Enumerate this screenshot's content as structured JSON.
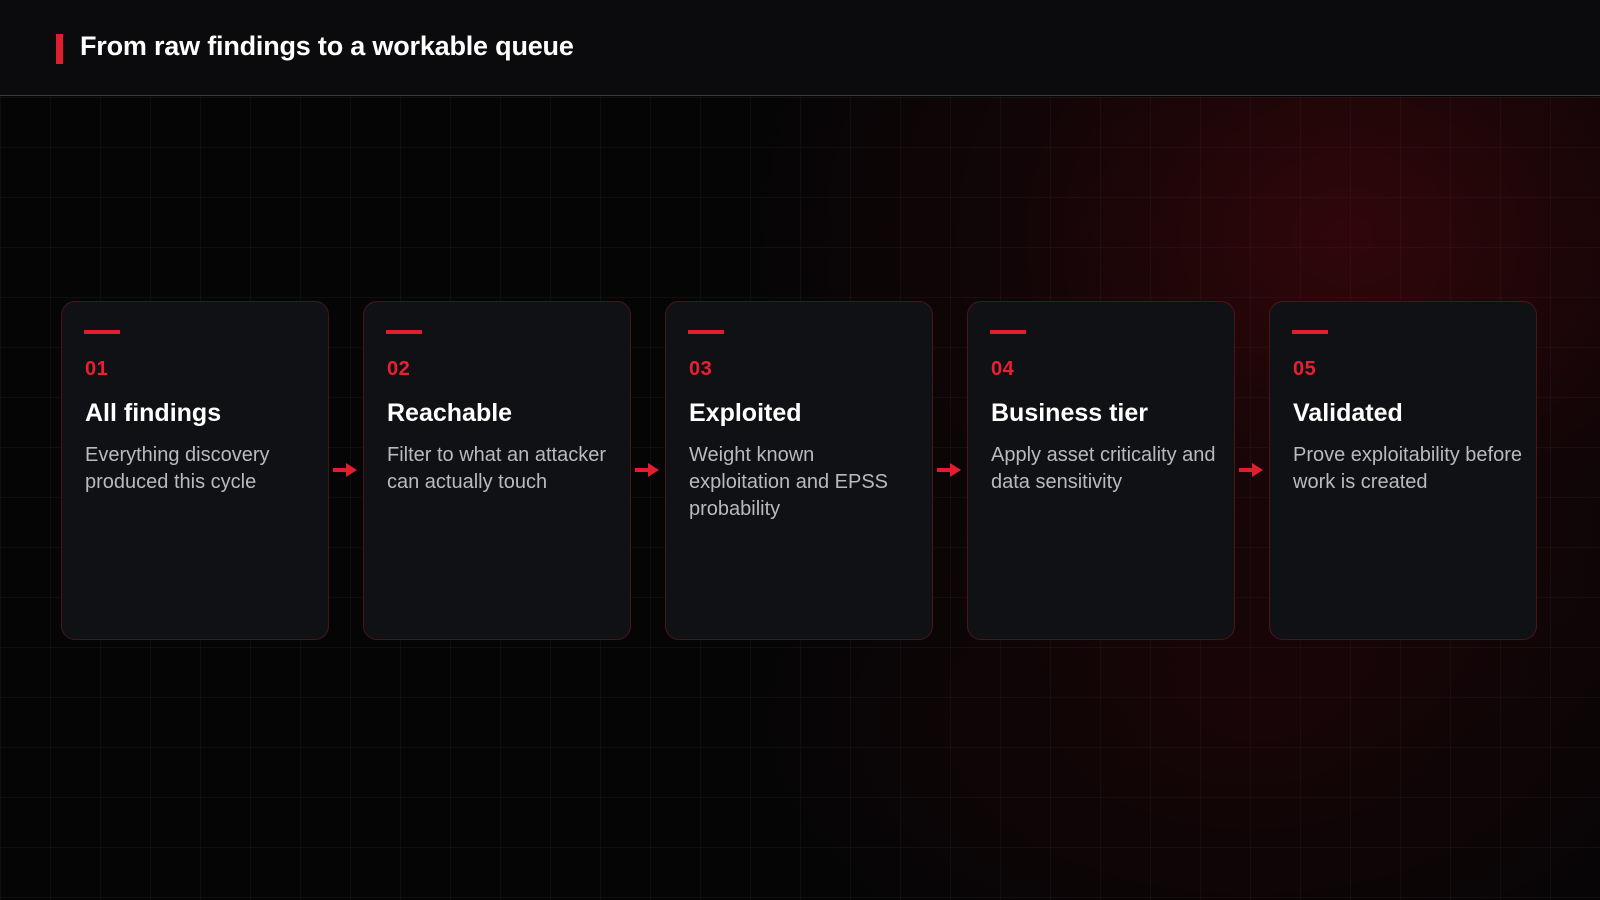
{
  "header": {
    "title": "From raw findings to a workable queue"
  },
  "colors": {
    "accent": "#e01e2d",
    "card_background": "#101115",
    "card_border": "#4a1519",
    "page_background": "#050506"
  },
  "steps": [
    {
      "number": "01",
      "title": "All findings",
      "description": "Everything discovery produced this cycle"
    },
    {
      "number": "02",
      "title": "Reachable",
      "description": "Filter to what an attacker can actually touch"
    },
    {
      "number": "03",
      "title": "Exploited",
      "description": "Weight known exploitation and EPSS probability"
    },
    {
      "number": "04",
      "title": "Business tier",
      "description": "Apply asset criticality and data sensitivity"
    },
    {
      "number": "05",
      "title": "Validated",
      "description": "Prove exploitability before work is created"
    }
  ],
  "connector_icon": "arrow-right-icon"
}
